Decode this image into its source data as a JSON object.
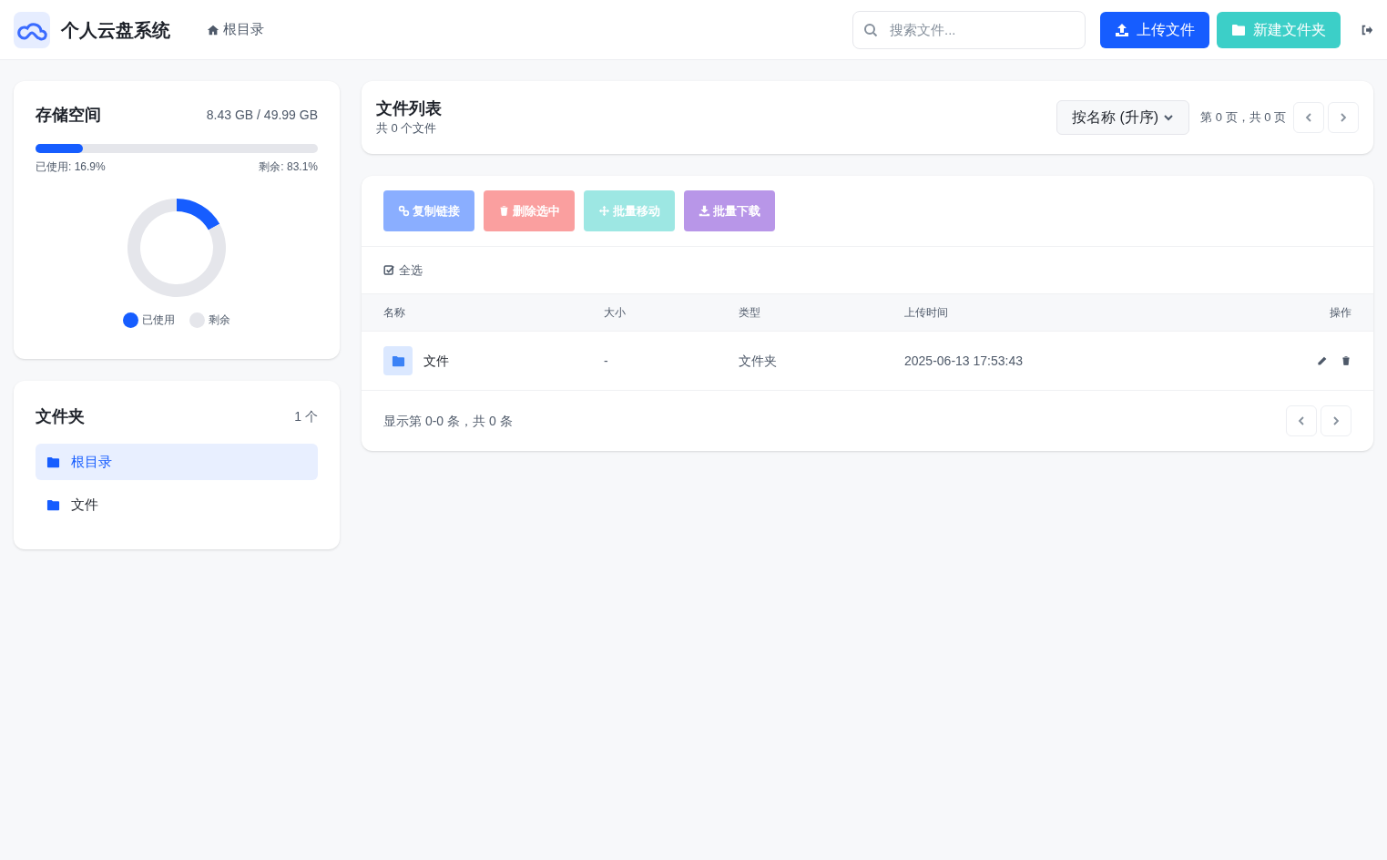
{
  "header": {
    "app_title": "个人云盘系统",
    "breadcrumb": "根目录",
    "search": {
      "placeholder": "搜索文件..."
    },
    "buttons": [
      {
        "label": "上传文件",
        "kind": "upload"
      },
      {
        "label": "新建文件夹",
        "kind": "folder"
      }
    ]
  },
  "storage": {
    "title": "存储空间",
    "usage": "8.43 GB / 49.99 GB",
    "level": 0.169,
    "used_label": "已使用: 16.9%",
    "free_label": "剩余: 83.1%",
    "chart_data": {
      "type": "donut",
      "categories": [
        "已使用",
        "剩余"
      ],
      "values": [
        16.9,
        83.1
      ],
      "colors": [
        "#165dff",
        "#e5e6eb"
      ],
      "legend": "bottom"
    }
  },
  "folders": {
    "title": "文件夹",
    "count": "1 个",
    "items": [
      {
        "label": "根目录",
        "selected": true
      },
      {
        "label": "文件",
        "selected": false
      }
    ]
  },
  "file_list": {
    "title": "文件列表",
    "subtitle": "共 0 个文件",
    "sort": "按名称 (升序)",
    "page_info": "第 0 页，共 0 页"
  },
  "actions": [
    {
      "label": "复制链接",
      "kind": "link",
      "disabled": true
    },
    {
      "label": "删除选中",
      "kind": "delete",
      "disabled": true
    },
    {
      "label": "批量移动",
      "kind": "move",
      "disabled": true
    },
    {
      "label": "批量下载",
      "kind": "download",
      "disabled": true
    }
  ],
  "select_all": {
    "label": "全选",
    "checked": true
  },
  "table": {
    "columns": [
      "名称",
      "大小",
      "类型",
      "上传时间",
      "操作"
    ],
    "rows": [
      {
        "name": "文件",
        "size": "-",
        "type": "文件夹",
        "time": "2025-06-13 17:53:43"
      }
    ]
  },
  "footer": {
    "info": "显示第 0-0 条，共 0 条"
  }
}
